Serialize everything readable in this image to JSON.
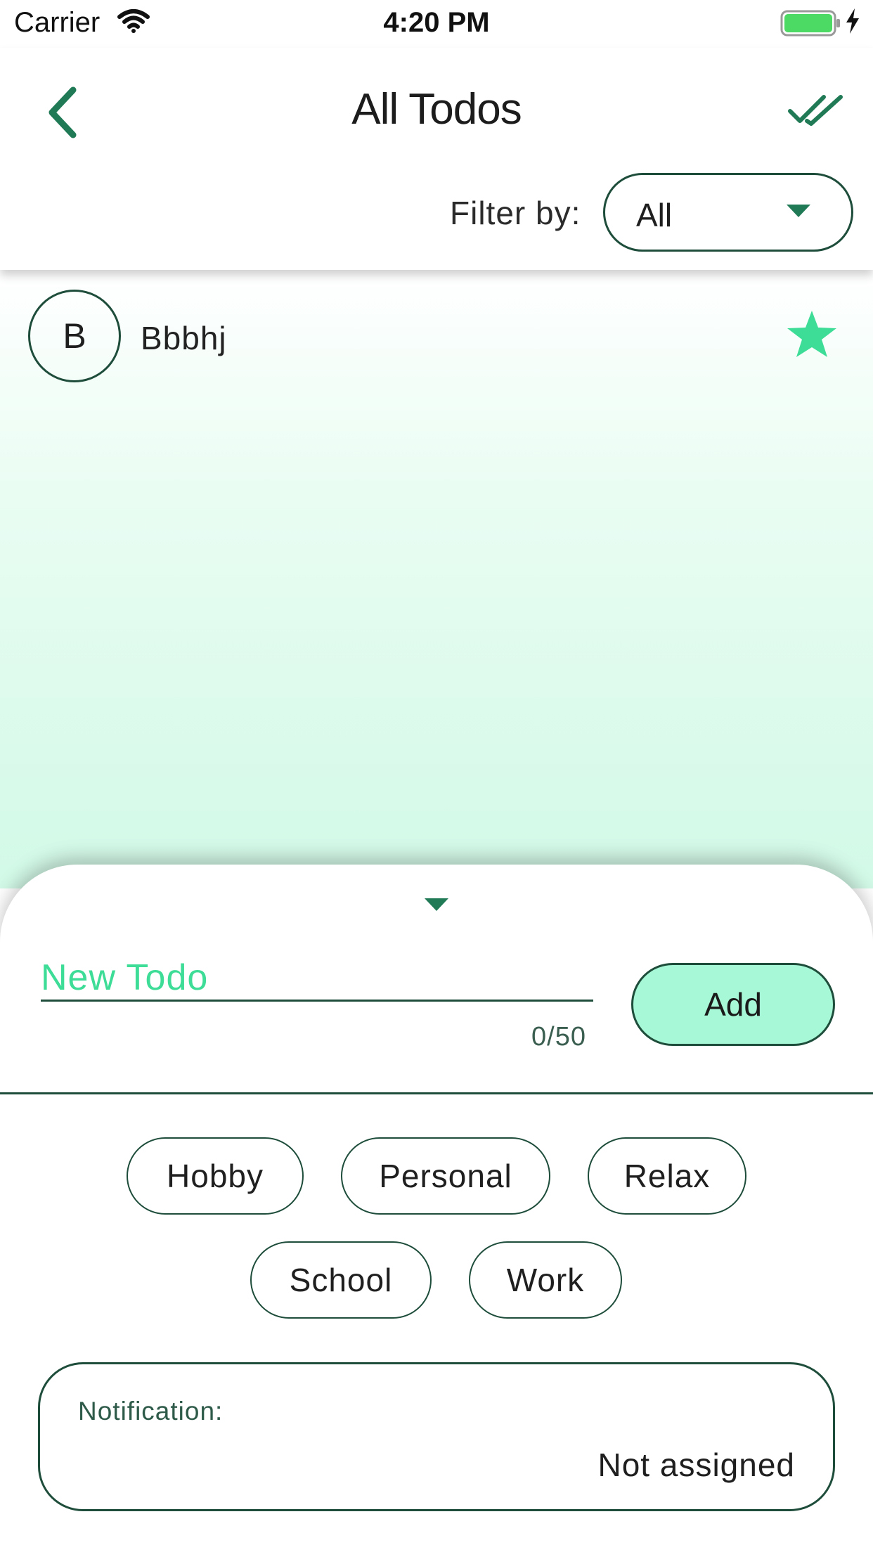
{
  "status_bar": {
    "carrier": "Carrier",
    "time": "4:20 PM",
    "icons": [
      "wifi-icon",
      "battery-icon",
      "charging-bolt-icon"
    ]
  },
  "header": {
    "title": "All Todos",
    "back_icon": "chevron-left-icon",
    "action_icon": "double-check-icon",
    "filter_label": "Filter by:",
    "filter_value": "All"
  },
  "todos": [
    {
      "avatar_letter": "B",
      "text": "Bbbhj",
      "starred": true
    }
  ],
  "composer": {
    "placeholder": "New Todo",
    "value": "",
    "counter": "0/50",
    "add_label": "Add"
  },
  "categories": [
    "Hobby",
    "Personal",
    "Relax",
    "School",
    "Work"
  ],
  "notification": {
    "label": "Notification:",
    "value": "Not assigned"
  },
  "colors": {
    "accent_dark": "#1e4d3b",
    "accent_green": "#1f7a55",
    "mint": "#3ddc97",
    "button_fill": "#a7f8d6",
    "battery": "#4cd964"
  }
}
